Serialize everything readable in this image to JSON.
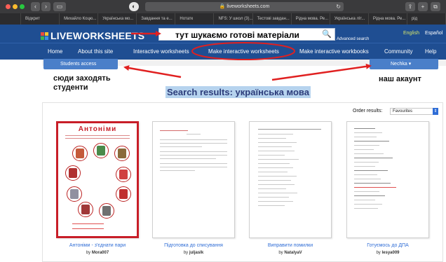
{
  "browser": {
    "url": "liveworksheets.com",
    "tabs": [
      "",
      "Відкрит",
      "Михайло Коцю...",
      "Українська мо...",
      "Завдання та е...",
      "Нотатк",
      "NFS: У школ (3)...",
      "Тестові завдан...",
      "Рідна мова. Ре...",
      "Українська літ...",
      "Рідна мова. Ре...",
      "рід"
    ]
  },
  "site": {
    "logo": "LIVEWORKSHEETS",
    "search_value": "тут шукаємо готові матеріали",
    "advanced_search": "Advanced search",
    "lang_english": "English",
    "lang_spanish": "Español",
    "menu": [
      "Home",
      "About this site",
      "Interactive worksheets",
      "Make interactive worksheets",
      "Make interactive workbooks",
      "Community",
      "Help"
    ],
    "students_access": "Students access",
    "account_name": "Nechka"
  },
  "annotations": {
    "students_note_line1": "сюди заходять",
    "students_note_line2": "студенти",
    "account_note": "наш акаунт"
  },
  "results": {
    "title": "Search results: українська мова",
    "order_label": "Order results:",
    "order_value": "Favourites",
    "items": [
      {
        "title": "Антоніми - з'єднати пари",
        "by": "by",
        "author": "Mora007",
        "sheet_heading": "Антоніми"
      },
      {
        "title": "Підготовка до списування",
        "by": "by",
        "author": "juljaslk"
      },
      {
        "title": "Виправити помилки",
        "by": "by",
        "author": "NatalyaV"
      },
      {
        "title": "Готуємось до ДПА",
        "by": "by",
        "author": "lesya009"
      }
    ]
  },
  "colors": {
    "header_blue": "#1f4e92",
    "button_blue": "#4a7fc9",
    "annotation_red": "#e02020",
    "link_blue": "#2f6dd6"
  }
}
